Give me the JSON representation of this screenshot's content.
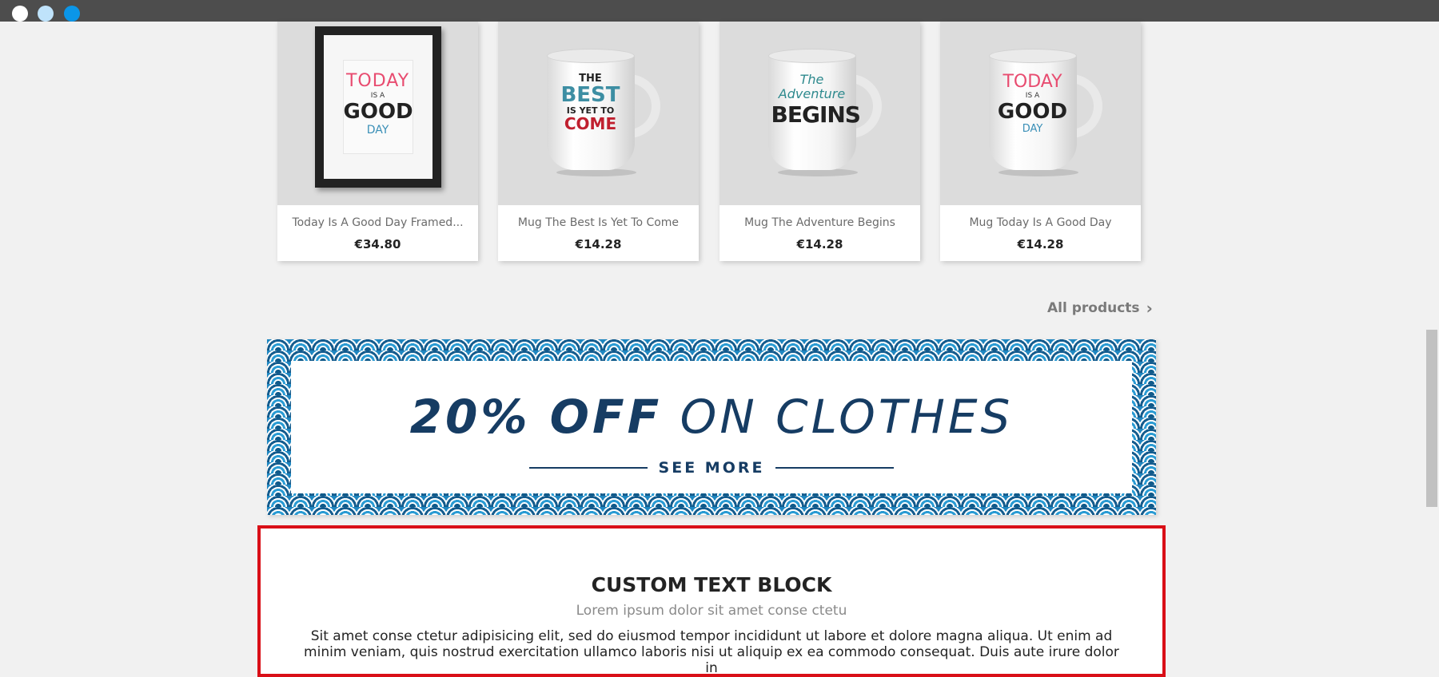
{
  "window": {
    "controls": [
      "close",
      "minimize",
      "maximize"
    ]
  },
  "products": [
    {
      "name": "Today Is A Good Day Framed...",
      "price": "€34.80",
      "image": "framed-poster-today-is-a-good-day",
      "art": [
        "TODAY",
        "IS A",
        "GOOD",
        "DAY"
      ]
    },
    {
      "name": "Mug The Best Is Yet To Come",
      "price": "€14.28",
      "image": "mug-the-best-is-yet-to-come",
      "art": [
        "THE",
        "BEST",
        "IS YET TO",
        "COME"
      ]
    },
    {
      "name": "Mug The Adventure Begins",
      "price": "€14.28",
      "image": "mug-the-adventure-begins",
      "art": [
        "The Adventure",
        "BEGINS"
      ]
    },
    {
      "name": "Mug Today Is A Good Day",
      "price": "€14.28",
      "image": "mug-today-is-a-good-day",
      "art": [
        "TODAY",
        "IS A",
        "GOOD",
        "DAY"
      ]
    }
  ],
  "all_products": {
    "label": "All products"
  },
  "banner": {
    "title_bold": "20% OFF",
    "title_rest": "ON CLOTHES",
    "cta": "SEE MORE",
    "colors": {
      "text": "#163c63",
      "pattern": "#1e86c0"
    }
  },
  "custom_text_block": {
    "title": "CUSTOM TEXT BLOCK",
    "subtitle": "Lorem ipsum dolor sit amet conse ctetu",
    "body": "Sit amet conse ctetur adipisicing elit, sed do eiusmod tempor incididunt ut labore et dolore magna aliqua. Ut enim ad minim veniam, quis nostrud exercitation ullamco laboris nisi ut aliquip ex ea commodo consequat. Duis aute irure dolor in",
    "highlight_color": "#d90f17"
  }
}
